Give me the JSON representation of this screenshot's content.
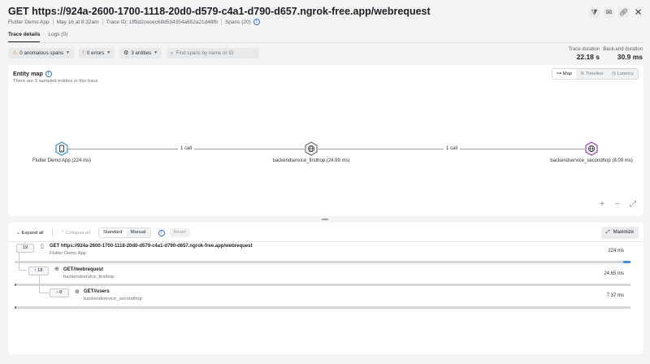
{
  "header": {
    "title": "GET https://924a-2600-1700-1118-20d0-d579-c4a1-d790-d657.ngrok-free.app/webrequest",
    "app": "Flutter Demo App",
    "date": "May 16 at 8:32am",
    "trace_id": "Trace ID: 1ff9d2cecec68d534354a652a21d48fb",
    "spans": "Spans (20)",
    "icons": [
      "filter-icon",
      "mail-icon",
      "link-icon",
      "close-icon"
    ]
  },
  "tabs": [
    {
      "label": "Trace details",
      "active": true
    },
    {
      "label": "Logs (0)",
      "active": false
    }
  ],
  "filters": {
    "anomalous": "0 anomalous spans",
    "errors": "0 errors",
    "entities": "3 entities",
    "search_placeholder": "Find spans by name or ID"
  },
  "durations": {
    "trace_label": "Trace duration",
    "trace_value": "22.18 s",
    "backend_label": "Back-end duration",
    "backend_value": "30.9 ms"
  },
  "entity_map": {
    "title": "Entity map",
    "subtitle": "There are 3 sampled entities in this trace",
    "views": [
      {
        "label": "Map",
        "active": true
      },
      {
        "label": "Timeline",
        "active": false
      },
      {
        "label": "Latency",
        "active": false
      }
    ],
    "nodes": [
      {
        "label": "Flutter Demo App (224 ms)",
        "color": "#2f8fd6",
        "icon": "mobile-app-icon"
      },
      {
        "label": "backendservice_firsthop (24.99 ms)",
        "color": "#6b7078",
        "icon": "globe-icon"
      },
      {
        "label": "backendservice_secondhop (8.09 ms)",
        "color": "#a23bc4",
        "icon": "globe-icon"
      }
    ],
    "edges": [
      {
        "label": "1 call"
      },
      {
        "label": "1 call"
      }
    ],
    "zoom": [
      "+",
      "−",
      "⤢"
    ]
  },
  "trace_toolbar": {
    "expand_all": "Expand all",
    "collapse_all": "Collapse all",
    "modes": [
      {
        "label": "Standard",
        "active": true
      },
      {
        "label": "Manual",
        "active": false
      }
    ],
    "reset": "Reset",
    "maximize": "Maximize"
  },
  "spans": [
    {
      "count": "19",
      "name": "GET https://924a-2600-1700-1118-20d0-d579-c4a1-d790-d657.ngrok-free.app/webrequest",
      "service": "Flutter Demo App",
      "duration": "224 ms",
      "icon": "mobile-app-icon",
      "start_fraction": 0.988,
      "width_fraction": 0.012,
      "color": "#3a8ee6"
    },
    {
      "count": "18",
      "name": "GET//webrequest",
      "service": "backendservice_firsthop",
      "duration": "24.65 ms",
      "icon": "globe-icon",
      "start_fraction": 0.0,
      "width_fraction": 0.002,
      "color": "#6b7078"
    },
    {
      "count": "8",
      "name": "GET//users",
      "service": "backendservice_secondhop",
      "duration": "7.37 ms",
      "icon": "globe-icon",
      "start_fraction": 0.0,
      "width_fraction": 0.002,
      "color": "#6b7078"
    }
  ]
}
